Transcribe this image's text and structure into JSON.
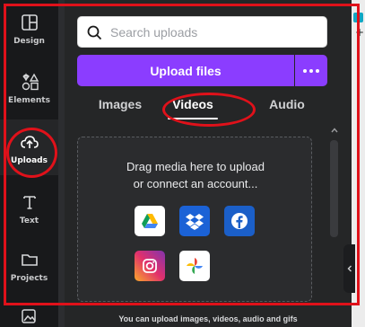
{
  "sidebar": {
    "items": [
      {
        "label": "Design",
        "icon": "layout-icon"
      },
      {
        "label": "Elements",
        "icon": "shapes-icon"
      },
      {
        "label": "Uploads",
        "icon": "cloud-upload-icon"
      },
      {
        "label": "Text",
        "icon": "text-icon"
      },
      {
        "label": "Projects",
        "icon": "folder-icon"
      }
    ]
  },
  "search": {
    "placeholder": "Search uploads"
  },
  "upload": {
    "label": "Upload files",
    "more_label": "•••"
  },
  "tabs": [
    {
      "label": "Images"
    },
    {
      "label": "Videos",
      "active": true
    },
    {
      "label": "Audio"
    }
  ],
  "dropzone": {
    "line1": "Drag media here to upload",
    "line2": "or connect an account...",
    "apps": [
      "google-drive-icon",
      "dropbox-icon",
      "facebook-icon",
      "instagram-icon",
      "google-photos-icon"
    ]
  },
  "footer": "You can upload images, videos, audio and gifs",
  "colors": {
    "accent": "#8b3dff",
    "annotation": "#e0111a"
  }
}
